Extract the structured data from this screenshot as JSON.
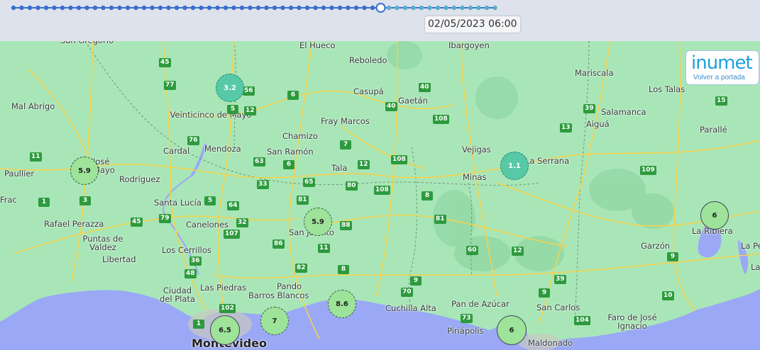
{
  "timeline": {
    "timestamp": "02/05/2023 06:00",
    "dot_count": 60,
    "selected_index": 45,
    "colors": {
      "played": "#3a6fd0",
      "remaining": "#5aaec6",
      "line": "#3a6fd0"
    }
  },
  "logo": {
    "brand": "inumet",
    "subtitle": "Volver a portada"
  },
  "colors": {
    "land": "#a8e6b8",
    "sea": "#9aa8f5",
    "road": "#f5d24a",
    "shield": "#2e9a3e",
    "marker_green": "#9ee39a",
    "marker_teal": "#57c9a6"
  },
  "places": [
    {
      "name": "San Gregorio"
    },
    {
      "name": "El Hueco"
    },
    {
      "name": "Reboledo"
    },
    {
      "name": "Ibargoyen"
    },
    {
      "name": "Mariscala"
    },
    {
      "name": "Los Talas"
    },
    {
      "name": "Mal Abrigo"
    },
    {
      "name": "Veinticinco de Mayo"
    },
    {
      "name": "Casupá"
    },
    {
      "name": "Gaetán"
    },
    {
      "name": "Salamanca"
    },
    {
      "name": "Aiguá"
    },
    {
      "name": "Parallé"
    },
    {
      "name": "Chamizo"
    },
    {
      "name": "Fray Marcos"
    },
    {
      "name": "Cardal"
    },
    {
      "name": "Mendoza"
    },
    {
      "name": "San Ramón"
    },
    {
      "name": "Vejigas"
    },
    {
      "name": "La Serrana"
    },
    {
      "name": "José"
    },
    {
      "name": "Mayo"
    },
    {
      "name": "Tala"
    },
    {
      "name": "Minas"
    },
    {
      "name": "Paullier"
    },
    {
      "name": "Rodríguez"
    },
    {
      "name": "Santa Lucía"
    },
    {
      "name": "La Ribiera"
    },
    {
      "name": "Rafael Perazza"
    },
    {
      "name": "Canelones"
    },
    {
      "name": "San Jacinto"
    },
    {
      "name": "Puntas de Valdez"
    },
    {
      "name": "Los Cerrillos"
    },
    {
      "name": "Garzón"
    },
    {
      "name": "Libertad"
    },
    {
      "name": "Las Piedras"
    },
    {
      "name": "Pando"
    },
    {
      "name": "Barros Blancos"
    },
    {
      "name": "Ciudad del Plata"
    },
    {
      "name": "Cuchilla Alta"
    },
    {
      "name": "Pan de Azúcar"
    },
    {
      "name": "San Carlos"
    },
    {
      "name": "Faro de José Ignacio"
    },
    {
      "name": "Piriápolis"
    },
    {
      "name": "Maldonado"
    },
    {
      "name": "Montevideo"
    },
    {
      "name": "La Pe"
    },
    {
      "name": "La Palo"
    },
    {
      "name": "Frac"
    }
  ],
  "routes": [
    "45",
    "77",
    "56",
    "5",
    "12",
    "6",
    "40",
    "40",
    "39",
    "15",
    "76",
    "108",
    "13",
    "7",
    "12",
    "108",
    "63",
    "6",
    "11",
    "65",
    "33",
    "80",
    "108",
    "8",
    "109",
    "3",
    "5",
    "64",
    "81",
    "45",
    "79",
    "107",
    "32",
    "88",
    "81",
    "1",
    "36",
    "86",
    "11",
    "60",
    "12",
    "48",
    "82",
    "8",
    "9",
    "9",
    "39",
    "70",
    "9",
    "102",
    "73",
    "104",
    "10",
    "1"
  ],
  "markers": [
    {
      "value": "3.2",
      "color": "teal"
    },
    {
      "value": "5.9",
      "color": "green"
    },
    {
      "value": "1.1",
      "color": "teal"
    },
    {
      "value": "5.9",
      "color": "green"
    },
    {
      "value": "6",
      "color": "green"
    },
    {
      "value": "8.6",
      "color": "green"
    },
    {
      "value": "6.5",
      "color": "green"
    },
    {
      "value": "7",
      "color": "green"
    },
    {
      "value": "6",
      "color": "green"
    }
  ]
}
